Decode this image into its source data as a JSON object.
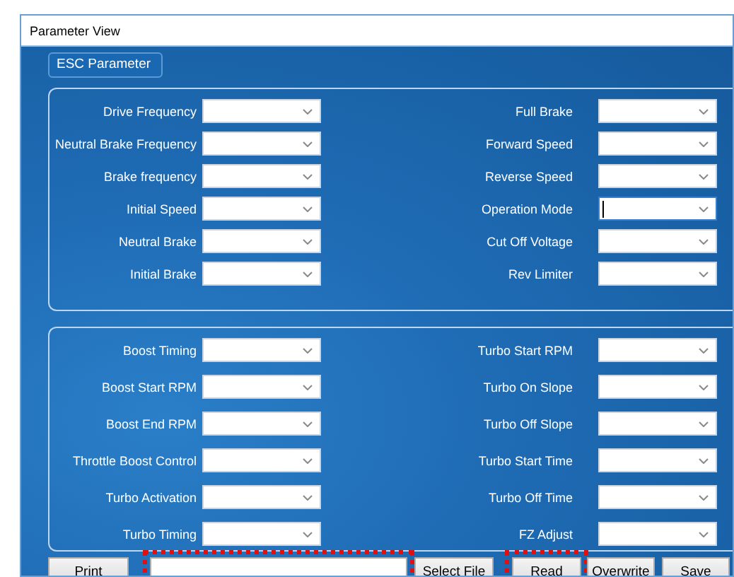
{
  "window": {
    "title": "Parameter View"
  },
  "groups": [
    {
      "title": "ESC Parameter",
      "left": [
        {
          "label": "Drive Frequency",
          "focused": false
        },
        {
          "label": "Neutral Brake Frequency",
          "focused": false
        },
        {
          "label": "Brake frequency",
          "focused": false
        },
        {
          "label": "Initial Speed",
          "focused": false
        },
        {
          "label": "Neutral Brake",
          "focused": false
        },
        {
          "label": "Initial Brake",
          "focused": false
        }
      ],
      "right": [
        {
          "label": "Full Brake",
          "focused": false
        },
        {
          "label": "Forward Speed",
          "focused": false
        },
        {
          "label": "Reverse Speed",
          "focused": false
        },
        {
          "label": "Operation Mode",
          "focused": true
        },
        {
          "label": "Cut Off Voltage",
          "focused": false
        },
        {
          "label": "Rev Limiter",
          "focused": false
        }
      ]
    },
    {
      "left": [
        {
          "label": "Boost Timing",
          "focused": false
        },
        {
          "label": "Boost Start RPM",
          "focused": false
        },
        {
          "label": "Boost End RPM",
          "focused": false
        },
        {
          "label": "Throttle Boost Control",
          "focused": false
        },
        {
          "label": "Turbo Activation",
          "focused": false
        },
        {
          "label": "Turbo Timing",
          "focused": false
        }
      ],
      "right": [
        {
          "label": "Turbo Start RPM",
          "focused": false
        },
        {
          "label": "Turbo On Slope",
          "focused": false
        },
        {
          "label": "Turbo Off Slope",
          "focused": false
        },
        {
          "label": "Turbo Start Time",
          "focused": false
        },
        {
          "label": "Turbo Off Time",
          "focused": false
        },
        {
          "label": "FZ Adjust",
          "focused": false
        }
      ]
    }
  ],
  "footer": [
    {
      "kind": "button",
      "label": "Print",
      "highlighted": false
    },
    {
      "kind": "field",
      "highlighted": true
    },
    {
      "kind": "button",
      "label": "Select File",
      "highlighted": false
    },
    {
      "kind": "button",
      "label": "Read",
      "highlighted": true
    },
    {
      "kind": "button",
      "label": "Overwrite",
      "highlighted": false
    },
    {
      "kind": "button",
      "label": "Save",
      "highlighted": false
    }
  ]
}
